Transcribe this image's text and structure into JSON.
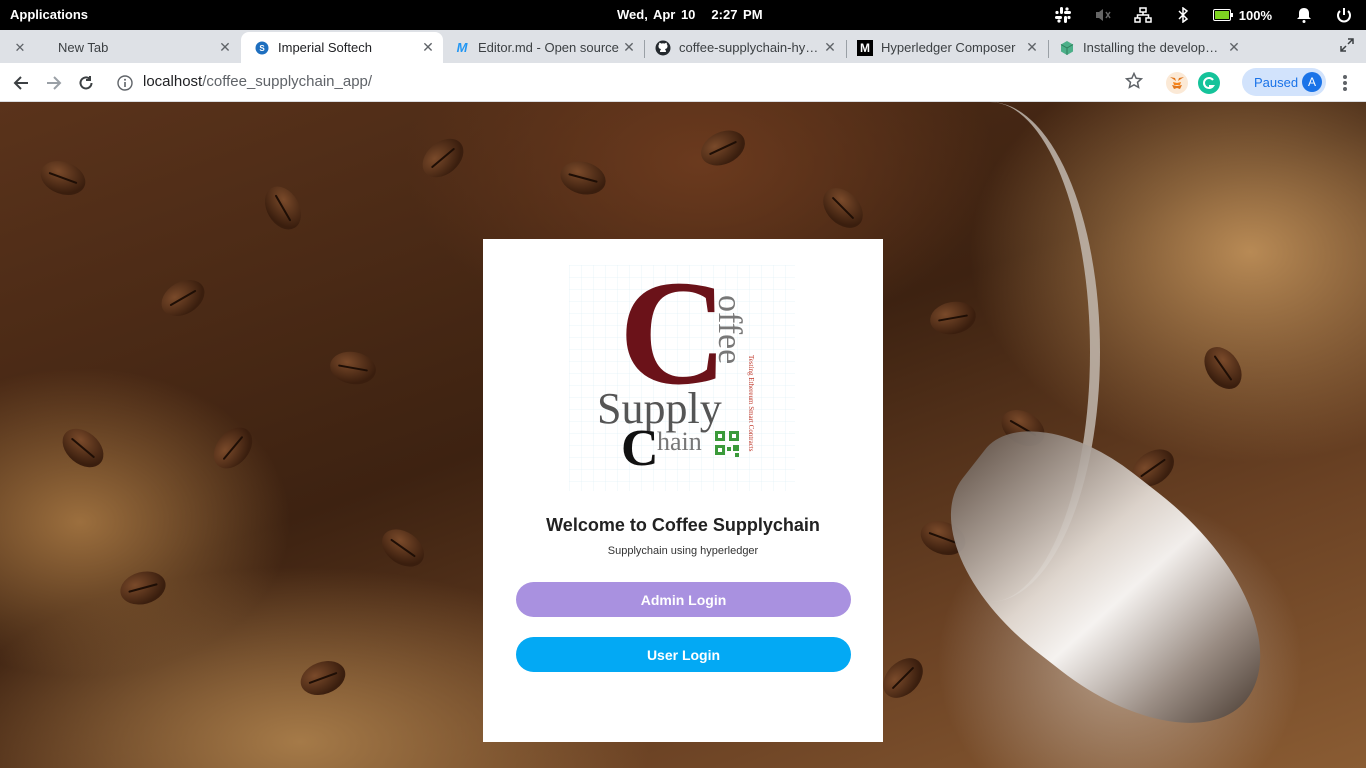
{
  "topbar": {
    "apps_label": "Applications",
    "date": "Wed, Apr 10",
    "time": "2:27 PM",
    "battery": "100%"
  },
  "tabs": [
    {
      "title": "New Tab",
      "icon": "close-icon"
    },
    {
      "title": "Imperial Softech",
      "icon": "imperial-favicon"
    },
    {
      "title": "Editor.md - Open source",
      "icon": "editor-md-favicon"
    },
    {
      "title": "coffee-supplychain-hype",
      "icon": "github-icon"
    },
    {
      "title": "Hyperledger Composer",
      "icon": "medium-icon"
    },
    {
      "title": "Installing the developme",
      "icon": "cube-icon"
    }
  ],
  "toolbar": {
    "url_host": "localhost",
    "url_path": "/coffee_supplychain_app/",
    "profile_status": "Paused",
    "avatar_letter": "A"
  },
  "card": {
    "logo": {
      "big_c": "C",
      "offee": "offee",
      "supply": "Supply",
      "chain_c": "C",
      "hain": "hain",
      "tagline": "Testing Ethereum Smart Contracts"
    },
    "welcome": "Welcome to Coffee Supplychain",
    "subtitle": "Supplychain using hyperledger",
    "admin_button": "Admin Login",
    "user_button": "User Login"
  },
  "colors": {
    "admin_button": "#a991e0",
    "user_button": "#03a9f4",
    "logo_maroon": "#6b1219"
  }
}
